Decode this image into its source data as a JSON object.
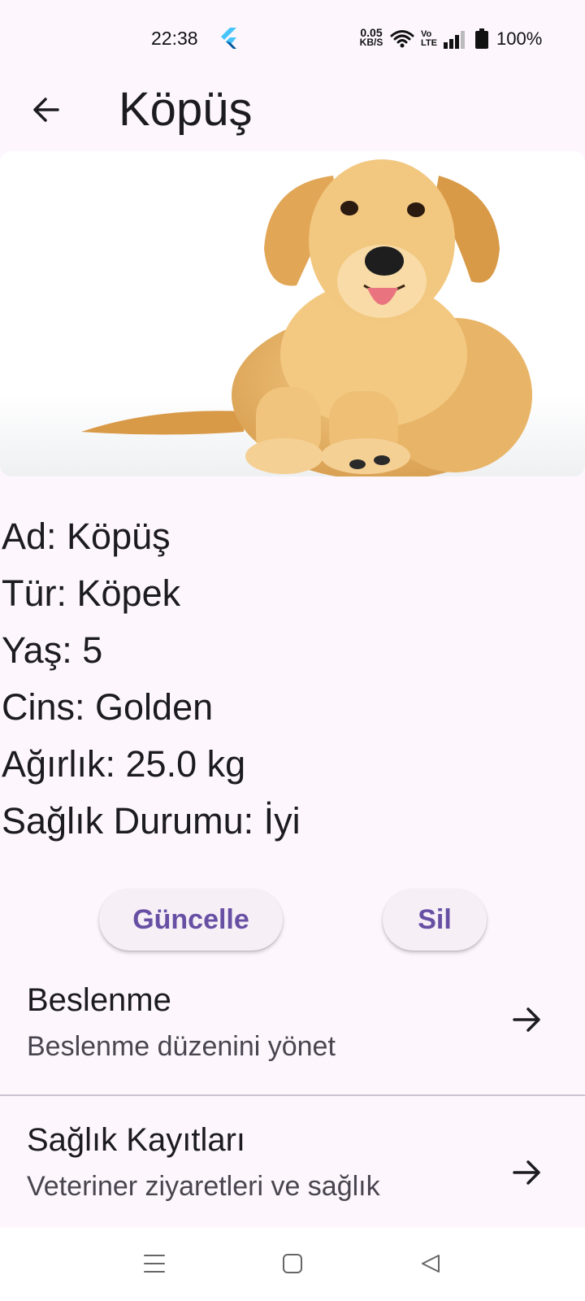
{
  "status_bar": {
    "time": "22:38",
    "net_speed_value": "0.05",
    "net_speed_unit": "KB/S",
    "volte_top": "Vo",
    "volte_bottom": "LTE",
    "battery": "100%",
    "icons": [
      "flutter-icon",
      "wifi-icon",
      "volte-icon",
      "signal-icon",
      "battery-icon"
    ]
  },
  "app_bar": {
    "title": "Köpüş",
    "back_icon": "arrow-left-icon"
  },
  "pet_photo": {
    "subject": "golden-retriever-puppy"
  },
  "pet_info": {
    "lines": [
      "Ad: Köpüş",
      "Tür: Köpek",
      "Yaş: 5",
      "Cins: Golden",
      "Ağırlık: 25.0 kg",
      "Sağlık Durumu: İyi"
    ]
  },
  "actions": {
    "update_label": "Güncelle",
    "delete_label": "Sil"
  },
  "menu": {
    "items": [
      {
        "title": "Beslenme",
        "subtitle": "Beslenme düzenini yönet",
        "icon": "arrow-right-icon"
      },
      {
        "title": "Sağlık Kayıtları",
        "subtitle": "Veteriner ziyaretleri ve sağlık",
        "icon": "arrow-right-icon"
      }
    ]
  },
  "nav_bar": {
    "icons": [
      "menu-icon",
      "home-icon",
      "back-triangle-icon"
    ]
  },
  "colors": {
    "background": "#fdf7fd",
    "accent": "#6750a4",
    "button_bg": "#f6eff6",
    "subtitle": "#49454f"
  }
}
